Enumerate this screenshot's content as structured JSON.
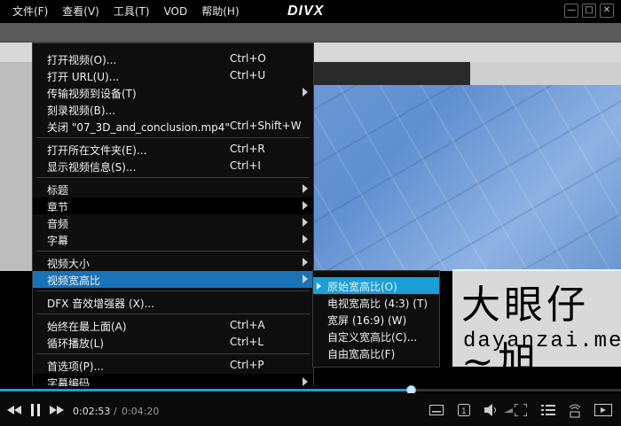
{
  "menubar": {
    "items": [
      "文件(F)",
      "查看(V)",
      "工具(T)",
      "VOD",
      "帮助(H)"
    ],
    "logo": "DIVX"
  },
  "window_buttons": [
    "—",
    "□",
    "✕"
  ],
  "main_menu": [
    {
      "label": "打开视频(O)...",
      "shortcut": "Ctrl+O"
    },
    {
      "label": "打开 URL(U)...",
      "shortcut": "Ctrl+U"
    },
    {
      "label": "传输视频到设备(T)",
      "shortcut": "",
      "submenu": true
    },
    {
      "label": "刻录视频(B)...",
      "shortcut": ""
    },
    {
      "label": "关闭 \"07_3D_and_conclusion.mp4\"",
      "shortcut": "Ctrl+Shift+W"
    },
    {
      "label": "打开所在文件夹(E)...",
      "shortcut": "Ctrl+R"
    },
    {
      "label": "显示视频信息(S)...",
      "shortcut": "Ctrl+I"
    },
    {
      "label": "标题",
      "shortcut": "",
      "submenu": true
    },
    {
      "label": "章节",
      "shortcut": "",
      "submenu": true
    },
    {
      "label": "音频",
      "shortcut": "",
      "submenu": true
    },
    {
      "label": "字幕",
      "shortcut": "",
      "submenu": true
    },
    {
      "label": "视频大小",
      "shortcut": "",
      "submenu": true
    },
    {
      "label": "视频宽高比",
      "shortcut": "",
      "submenu": true
    },
    {
      "label": "DFX 音效增强器 (X)...",
      "shortcut": ""
    },
    {
      "label": "始终在最上面(A)",
      "shortcut": "Ctrl+A"
    },
    {
      "label": "循环播放(L)",
      "shortcut": "Ctrl+L"
    },
    {
      "label": "首选项(P)...",
      "shortcut": "Ctrl+P"
    },
    {
      "label": "字幕编码",
      "shortcut": "",
      "submenu": true
    }
  ],
  "aspect_submenu": [
    {
      "label": "原始宽高比(O)",
      "selected": true
    },
    {
      "label": "电视宽高比 (4:3) (T)"
    },
    {
      "label": "宽屏 (16:9) (W)"
    },
    {
      "label": "自定义宽高比(C)..."
    },
    {
      "label": "自由宽高比(F)"
    }
  ],
  "watermark": {
    "cn": "大眼仔~旭",
    "en": "dayanzai.me"
  },
  "playback": {
    "current_time": "0:02:53",
    "separator": "/",
    "total_time": "0:04:20",
    "progress": 0.663
  },
  "colors": {
    "highlight": "#1a72b8",
    "submenu_highlight": "#1a9fd8",
    "menu_bg": "#0e0e0e"
  }
}
